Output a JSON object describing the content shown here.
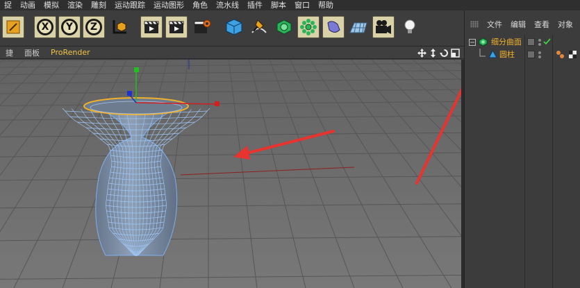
{
  "menubar": {
    "items": [
      "捉",
      "动画",
      "模拟",
      "渲染",
      "雕刻",
      "运动跟踪",
      "运动图形",
      "角色",
      "流水线",
      "插件",
      "脚本",
      "窗口",
      "帮助"
    ]
  },
  "toolbar": {
    "axis_x": "X",
    "axis_y": "Y",
    "axis_z": "Z"
  },
  "viewport_menu": {
    "items": [
      "捷",
      "面板",
      "ProRender"
    ]
  },
  "object_manager": {
    "menu": [
      "文件",
      "编辑",
      "查看",
      "对象"
    ],
    "tree": [
      {
        "label": "细分曲面",
        "icon": "subdivision-surface-icon",
        "level": 0
      },
      {
        "label": "圆柱",
        "icon": "cylinder-icon",
        "level": 1
      }
    ]
  },
  "colors": {
    "accent_orange": "#f0b02a",
    "annotation_red": "#e8332f",
    "viewport_bg": "#6b6b6b",
    "mesh_blue": "#6f9bd6"
  }
}
